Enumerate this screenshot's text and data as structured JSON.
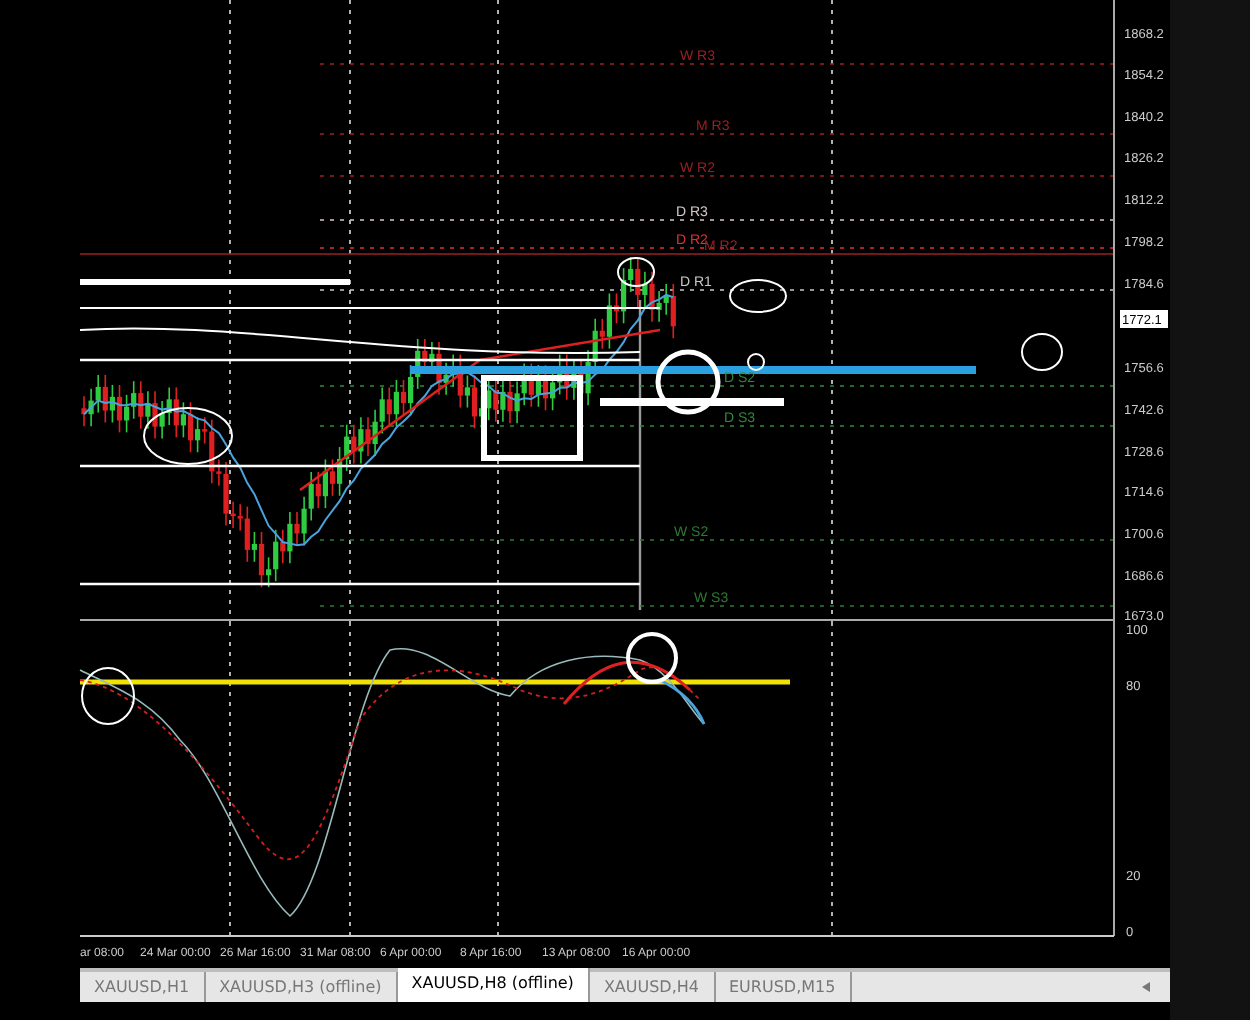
{
  "price_axis": {
    "labels": [
      "1868.2",
      "1854.2",
      "1840.2",
      "1826.2",
      "1812.2",
      "1798.2",
      "1784.6",
      "1756.6",
      "1742.6",
      "1728.6",
      "1714.6",
      "1700.6",
      "1686.6",
      "1673.0"
    ],
    "current_price": "1772.1"
  },
  "levels": [
    {
      "label": "W R3",
      "color": "#9a2020"
    },
    {
      "label": "M R3",
      "color": "#9a2020"
    },
    {
      "label": "W R2",
      "color": "#9a2020"
    },
    {
      "label": "D R3",
      "color": "#d8c8c8"
    },
    {
      "label": "D R2",
      "color": "#e03030"
    },
    {
      "label": "M R2",
      "color": "#9a2020"
    },
    {
      "label": "D R1",
      "color": "#c8c8c8"
    },
    {
      "label": "D S2",
      "color": "#2f8a3a"
    },
    {
      "label": "D S3",
      "color": "#2f8a3a"
    },
    {
      "label": "W S2",
      "color": "#2f7a34"
    },
    {
      "label": "W S3",
      "color": "#2f7a34"
    }
  ],
  "oscillator": {
    "labels": [
      "100",
      "80",
      "20",
      "0"
    ]
  },
  "time_axis": {
    "labels": [
      "ar 08:00",
      "24 Mar 00:00",
      "26 Mar 16:00",
      "31 Mar 08:00",
      "6 Apr 00:00",
      "8 Apr 16:00",
      "13 Apr 08:00",
      "16 Apr 00:00"
    ]
  },
  "tabs": [
    {
      "label": "XAUUSD,H1",
      "selected": false
    },
    {
      "label": "XAUUSD,H3 (offline)",
      "selected": false
    },
    {
      "label": "XAUUSD,H8 (offline)",
      "selected": true
    },
    {
      "label": "XAUUSD,H4",
      "selected": false
    },
    {
      "label": "EURUSD,M15",
      "selected": false
    }
  ]
}
